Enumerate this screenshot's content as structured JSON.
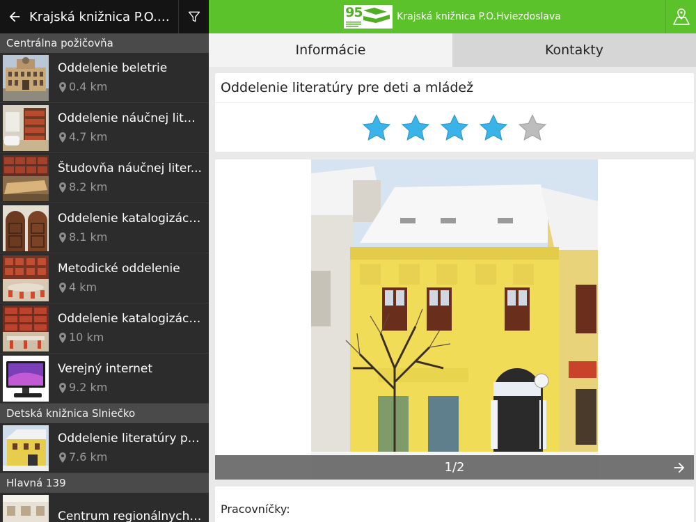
{
  "left_header": {
    "title": "Krajská knižnica P.O.Hv..."
  },
  "sections": [
    {
      "name": "Centrálna požičovňa"
    },
    {
      "name": "Detská knižnica Slniečko"
    },
    {
      "name": "Hlavná 139"
    }
  ],
  "items": [
    {
      "name": "Oddelenie beletrie",
      "distance": "0.4 km",
      "thumb": "historic-building"
    },
    {
      "name": "Oddelenie náučnej liter...",
      "distance": "4.7 km",
      "thumb": "bookshelf-room"
    },
    {
      "name": "Študovňa náučnej liter...",
      "distance": "8.2 km",
      "thumb": "reading-room"
    },
    {
      "name": "Oddelenie katalogizáci...",
      "distance": "8.1 km",
      "thumb": "wooden-doors"
    },
    {
      "name": "Metodické oddelenie",
      "distance": "4 km",
      "thumb": "library-tables"
    },
    {
      "name": "Oddelenie katalogizáci...",
      "distance": "10 km",
      "thumb": "library-shelves"
    },
    {
      "name": "Verejný internet",
      "distance": "9.2 km",
      "thumb": "computer-monitor"
    },
    {
      "name": "Oddelenie literatúry pr...",
      "distance": "7.6 km",
      "thumb": "yellow-building"
    },
    {
      "name": "Centrum regionálnych ...",
      "distance": "",
      "thumb": "gallery-room"
    }
  ],
  "top_bar": {
    "logo_number": "95",
    "app_name": "Krajská knižnica P.O.Hviezdoslava"
  },
  "tabs": [
    {
      "label": "Informácie",
      "active": true
    },
    {
      "label": "Kontakty",
      "active": false
    }
  ],
  "detail": {
    "title": "Oddelenie literatúry pre deti a mládež",
    "rating": 4,
    "rating_max": 5,
    "pager": "1/2",
    "staff_label": "Pracovníčky:"
  },
  "colors": {
    "accent": "#5cc22b",
    "star_filled": "#3ab4e8",
    "star_empty": "#bdbdbd"
  }
}
